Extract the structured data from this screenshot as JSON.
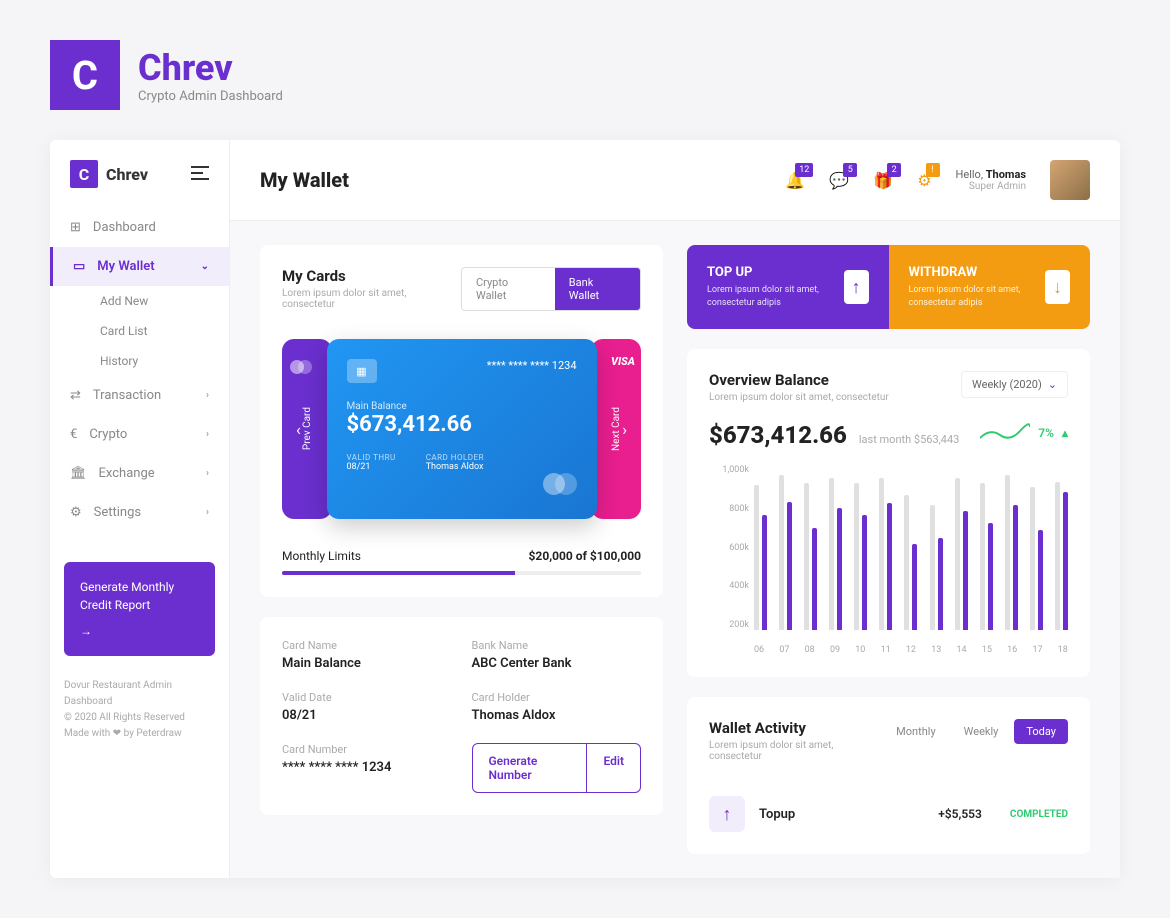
{
  "brand": {
    "name": "Chrev",
    "subtitle": "Crypto Admin Dashboard",
    "logo": "C"
  },
  "sidebar": {
    "logo": "Chrev",
    "items": [
      {
        "icon": "⊞",
        "label": "Dashboard"
      },
      {
        "icon": "▭",
        "label": "My Wallet",
        "active": true
      },
      {
        "icon": "⇄",
        "label": "Transaction"
      },
      {
        "icon": "€",
        "label": "Crypto"
      },
      {
        "icon": "🏛",
        "label": "Exchange"
      },
      {
        "icon": "⚙",
        "label": "Settings"
      }
    ],
    "wallet_sub": [
      "Add New",
      "Card List",
      "History"
    ],
    "report": {
      "title": "Generate Monthly Credit Report"
    },
    "footer": {
      "line1": "Dovur Restaurant Admin Dashboard",
      "line2": "© 2020 All Rights Reserved",
      "line3": "Made with ❤ by Peterdraw"
    }
  },
  "topbar": {
    "title": "My Wallet",
    "badges": {
      "bell": "12",
      "chat": "5",
      "gift": "2",
      "gear": "!"
    },
    "user": {
      "hello": "Hello,",
      "name": "Thomas",
      "role": "Super Admin"
    }
  },
  "cards": {
    "title": "My Cards",
    "sub": "Lorem ipsum dolor sit amet, consectetur",
    "seg": [
      "Crypto Wallet",
      "Bank Wallet"
    ],
    "prev": "Prev Card",
    "next": "Next Card",
    "main": {
      "masked": "**** **** **** 1234",
      "label": "Main Balance",
      "balance": "$673,412.66",
      "valid_lbl": "VALID THRU",
      "valid": "08/21",
      "holder_lbl": "CARD HOLDER",
      "holder": "Thomas Aldox"
    },
    "limits": {
      "label": "Monthly Limits",
      "value": "$20,000 of $100,000"
    }
  },
  "details": {
    "card_name": {
      "lbl": "Card Name",
      "val": "Main Balance"
    },
    "bank_name": {
      "lbl": "Bank Name",
      "val": "ABC Center Bank"
    },
    "valid": {
      "lbl": "Valid Date",
      "val": "08/21"
    },
    "holder": {
      "lbl": "Card Holder",
      "val": "Thomas Aldox"
    },
    "number": {
      "lbl": "Card Number",
      "val": "**** **** **** 1234"
    },
    "gen": "Generate Number",
    "edit": "Edit"
  },
  "actions": {
    "topup": {
      "title": "TOP UP",
      "sub": "Lorem ipsum dolor sit amet, consectetur adipis"
    },
    "withdraw": {
      "title": "WITHDRAW",
      "sub": "Lorem ipsum dolor sit amet, consectetur adipis"
    }
  },
  "overview": {
    "title": "Overview Balance",
    "sub": "Lorem ipsum dolor sit amet, consectetur",
    "dropdown": "Weekly (2020)",
    "balance": "$673,412.66",
    "last": "last month $563,443",
    "trend": "7%"
  },
  "activity": {
    "title": "Wallet Activity",
    "sub": "Lorem ipsum dolor sit amet, consectetur",
    "tabs": [
      "Monthly",
      "Weekly",
      "Today"
    ],
    "item": {
      "name": "Topup",
      "amount": "+$5,553",
      "status": "COMPLETED"
    }
  },
  "chart_data": {
    "type": "bar",
    "y_ticks": [
      "1,000k",
      "800k",
      "600k",
      "400k",
      "200k"
    ],
    "categories": [
      "06",
      "07",
      "08",
      "09",
      "10",
      "11",
      "12",
      "13",
      "14",
      "15",
      "16",
      "17",
      "18"
    ],
    "series": [
      {
        "name": "grey",
        "values": [
          880,
          940,
          890,
          920,
          890,
          920,
          820,
          760,
          920,
          890,
          940,
          870,
          900
        ]
      },
      {
        "name": "purple",
        "values": [
          700,
          780,
          620,
          740,
          700,
          770,
          520,
          560,
          720,
          650,
          760,
          610,
          840
        ]
      }
    ],
    "ylim": [
      0,
      1000
    ]
  }
}
